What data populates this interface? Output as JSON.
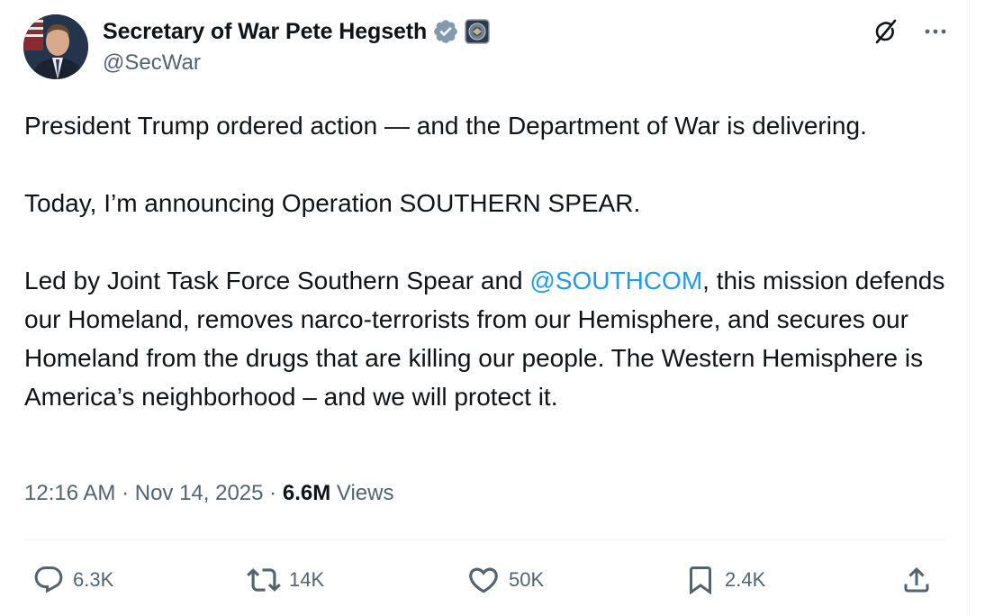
{
  "author": {
    "display_name": "Secretary of War Pete Hegseth",
    "handle": "@SecWar",
    "verified_badge_icon": "verified-badge-icon",
    "affiliation_icon": "department-seal-icon",
    "badge_color": "#829aab"
  },
  "header_actions": {
    "grok_icon": "grok-icon",
    "more_icon": "more-icon"
  },
  "tweet": {
    "para1": "President Trump ordered action — and the Department of War is delivering.",
    "para2": "Today, I’m announcing Operation SOUTHERN SPEAR.",
    "para3_before": "Led by Joint Task Force Southern Spear and ",
    "para3_mention": "@SOUTHCOM",
    "para3_after": ", this mission defends our Homeland, removes narco-terrorists from our Hemisphere, and secures our Homeland from the drugs that are killing our people. The Western Hemisphere is America’s neighborhood – and we will protect it."
  },
  "meta": {
    "time": "12:16 AM",
    "sep1": " · ",
    "date": "Nov 14, 2025",
    "sep2": " · ",
    "views_count": "6.6M",
    "views_label": " Views"
  },
  "actions": {
    "replies": "6.3K",
    "reposts": "14K",
    "likes": "50K",
    "bookmarks": "2.4K"
  },
  "colors": {
    "text": "#0f1419",
    "secondary": "#536471",
    "link": "#1d9bf0",
    "divider": "#eff3f4"
  }
}
